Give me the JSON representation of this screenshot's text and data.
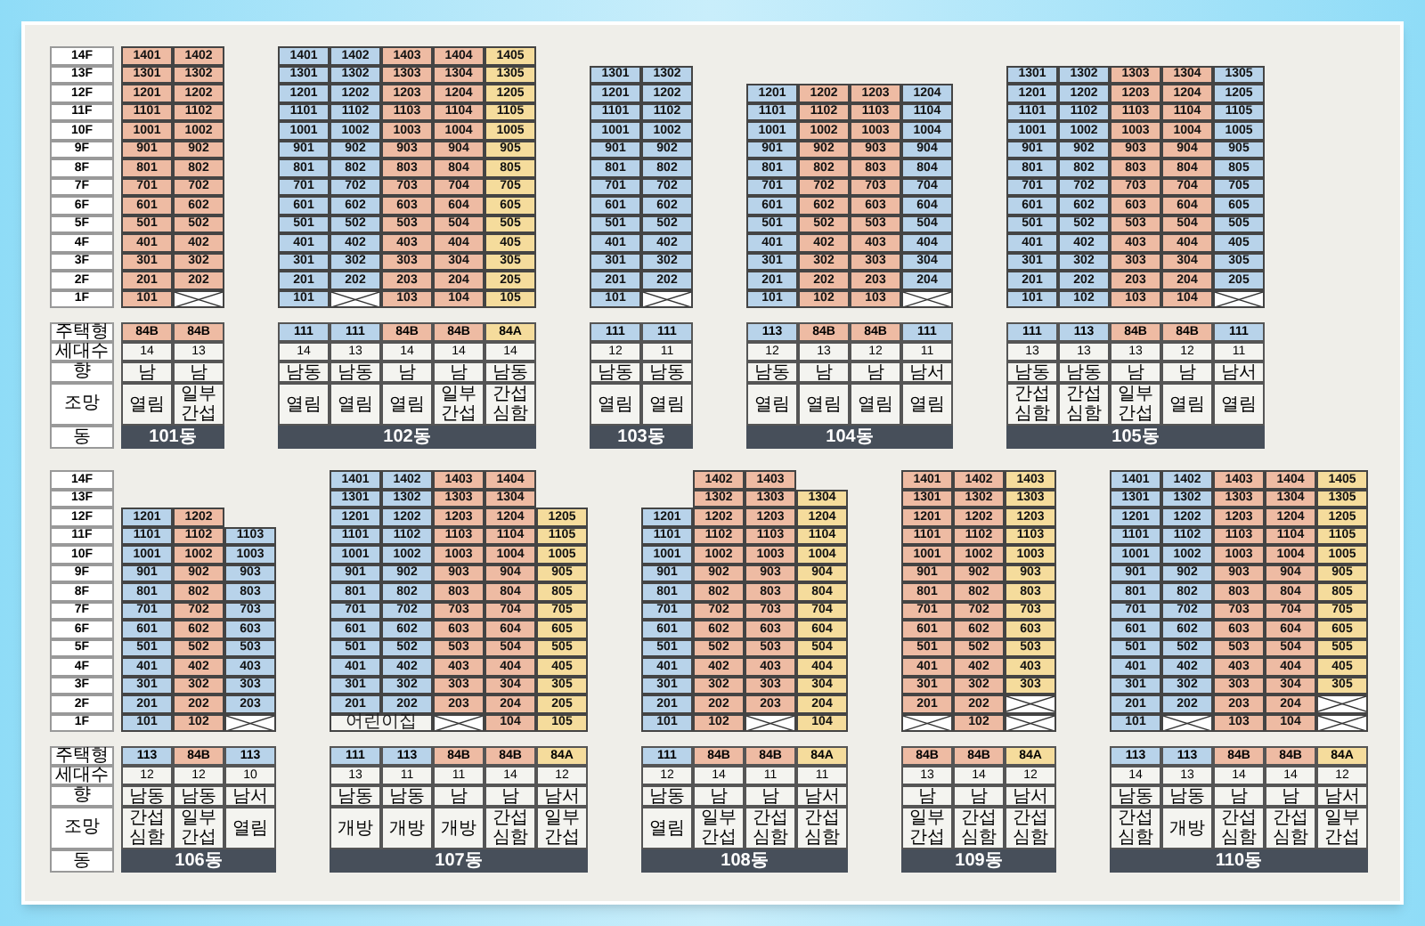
{
  "bands": [
    {
      "floor_labels": [
        "14F",
        "13F",
        "12F",
        "11F",
        "10F",
        "9F",
        "8F",
        "7F",
        "6F",
        "5F",
        "4F",
        "3F",
        "2F",
        "1F"
      ],
      "info_labels": [
        "주택형",
        "세대수",
        "향",
        "조망",
        "동"
      ],
      "buildings": [
        {
          "name": "101동",
          "columns": [
            {
              "color": "#eebba3",
              "type": "84B",
              "count": "14",
              "direction": "남",
              "view": "열림",
              "cells": [
                "1401",
                "1301",
                "1201",
                "1101",
                "1001",
                "901",
                "801",
                "701",
                "601",
                "501",
                "401",
                "301",
                "201",
                "101"
              ]
            },
            {
              "color": "#eebba3",
              "type": "84B",
              "count": "13",
              "direction": "남",
              "view": "일부간섭",
              "cells": [
                "1402",
                "1302",
                "1202",
                "1102",
                "1002",
                "902",
                "802",
                "702",
                "602",
                "502",
                "402",
                "302",
                "202",
                null
              ]
            }
          ]
        },
        {
          "name": "102동",
          "columns": [
            {
              "color": "#b8d3ea",
              "type": "111",
              "count": "14",
              "direction": "남동",
              "view": "열림",
              "cells": [
                "1401",
                "1301",
                "1201",
                "1101",
                "1001",
                "901",
                "801",
                "701",
                "601",
                "501",
                "401",
                "301",
                "201",
                "101"
              ]
            },
            {
              "color": "#b8d3ea",
              "type": "111",
              "count": "13",
              "direction": "남동",
              "view": "열림",
              "cells": [
                "1402",
                "1302",
                "1202",
                "1102",
                "1002",
                "902",
                "802",
                "702",
                "602",
                "502",
                "402",
                "302",
                "202",
                null
              ]
            },
            {
              "color": "#eebba3",
              "type": "84B",
              "count": "14",
              "direction": "남",
              "view": "열림",
              "cells": [
                "1403",
                "1303",
                "1203",
                "1103",
                "1003",
                "903",
                "803",
                "703",
                "603",
                "503",
                "403",
                "303",
                "203",
                "103"
              ]
            },
            {
              "color": "#eebba3",
              "type": "84B",
              "count": "14",
              "direction": "남",
              "view": "일부간섭",
              "cells": [
                "1404",
                "1304",
                "1204",
                "1104",
                "1004",
                "904",
                "804",
                "704",
                "604",
                "504",
                "404",
                "304",
                "204",
                "104"
              ]
            },
            {
              "color": "#f5dc9c",
              "type": "84A",
              "count": "14",
              "direction": "남동",
              "view": "간섭심함",
              "cells": [
                "1405",
                "1305",
                "1205",
                "1105",
                "1005",
                "905",
                "805",
                "705",
                "605",
                "505",
                "405",
                "305",
                "205",
                "105"
              ]
            }
          ]
        },
        {
          "name": "103동",
          "columns": [
            {
              "color": "#b8d3ea",
              "type": "111",
              "count": "12",
              "direction": "남동",
              "view": "열림",
              "cells": [
                "1301",
                "1201",
                "1101",
                "1001",
                "901",
                "801",
                "701",
                "601",
                "501",
                "401",
                "301",
                "201",
                "101"
              ]
            },
            {
              "color": "#b8d3ea",
              "type": "111",
              "count": "11",
              "direction": "남동",
              "view": "열림",
              "cells": [
                "1302",
                "1202",
                "1102",
                "1002",
                "902",
                "802",
                "702",
                "602",
                "502",
                "402",
                "302",
                "202",
                null
              ]
            }
          ]
        },
        {
          "name": "104동",
          "columns": [
            {
              "color": "#b8d3ea",
              "type": "113",
              "count": "12",
              "direction": "남동",
              "view": "열림",
              "cells": [
                "1201",
                "1101",
                "1001",
                "901",
                "801",
                "701",
                "601",
                "501",
                "401",
                "301",
                "201",
                "101"
              ]
            },
            {
              "color": "#eebba3",
              "type": "84B",
              "count": "13",
              "direction": "남",
              "view": "열림",
              "cells": [
                "1202",
                "1102",
                "1002",
                "902",
                "802",
                "702",
                "602",
                "502",
                "402",
                "302",
                "202",
                "102"
              ]
            },
            {
              "color": "#eebba3",
              "type": "84B",
              "count": "12",
              "direction": "남",
              "view": "열림",
              "cells": [
                "1203",
                "1103",
                "1003",
                "903",
                "803",
                "703",
                "603",
                "503",
                "403",
                "303",
                "203",
                "103"
              ]
            },
            {
              "color": "#b8d3ea",
              "type": "111",
              "count": "11",
              "direction": "남서",
              "view": "열림",
              "cells": [
                "1204",
                "1104",
                "1004",
                "904",
                "804",
                "704",
                "604",
                "504",
                "404",
                "304",
                "204",
                null
              ]
            }
          ]
        },
        {
          "name": "105동",
          "columns": [
            {
              "color": "#b8d3ea",
              "type": "111",
              "count": "13",
              "direction": "남동",
              "view": "간섭심함",
              "cells": [
                "1301",
                "1201",
                "1101",
                "1001",
                "901",
                "801",
                "701",
                "601",
                "501",
                "401",
                "301",
                "201",
                "101"
              ]
            },
            {
              "color": "#b8d3ea",
              "type": "113",
              "count": "13",
              "direction": "남동",
              "view": "간섭심함",
              "cells": [
                "1302",
                "1202",
                "1102",
                "1002",
                "902",
                "802",
                "702",
                "602",
                "502",
                "402",
                "302",
                "202",
                "102"
              ]
            },
            {
              "color": "#eebba3",
              "type": "84B",
              "count": "13",
              "direction": "남",
              "view": "일부간섭",
              "cells": [
                "1303",
                "1203",
                "1103",
                "1003",
                "903",
                "803",
                "703",
                "603",
                "503",
                "403",
                "303",
                "203",
                "103"
              ]
            },
            {
              "color": "#eebba3",
              "type": "84B",
              "count": "12",
              "direction": "남",
              "view": "열림",
              "cells": [
                "1304",
                "1204",
                "1104",
                "1004",
                "904",
                "804",
                "704",
                "604",
                "504",
                "404",
                "304",
                "204",
                "104"
              ]
            },
            {
              "color": "#b8d3ea",
              "type": "111",
              "count": "11",
              "direction": "남서",
              "view": "열림",
              "cells": [
                "1305",
                "1205",
                "1105",
                "1005",
                "905",
                "805",
                "705",
                "605",
                "505",
                "405",
                "305",
                "205",
                null
              ]
            }
          ]
        }
      ]
    },
    {
      "floor_labels": [
        "14F",
        "13F",
        "12F",
        "11F",
        "10F",
        "9F",
        "8F",
        "7F",
        "6F",
        "5F",
        "4F",
        "3F",
        "2F",
        "1F"
      ],
      "info_labels": [
        "주택형",
        "세대수",
        "향",
        "조망",
        "동"
      ],
      "buildings": [
        {
          "name": "106동",
          "columns": [
            {
              "color": "#b8d3ea",
              "type": "113",
              "count": "12",
              "direction": "남동",
              "view": "간섭심함",
              "cells": [
                "1201",
                "1101",
                "1001",
                "901",
                "801",
                "701",
                "601",
                "501",
                "401",
                "301",
                "201",
                "101"
              ]
            },
            {
              "color": "#eebba3",
              "type": "84B",
              "count": "12",
              "direction": "남동",
              "view": "일부간섭",
              "cells": [
                "1202",
                "1102",
                "1002",
                "902",
                "802",
                "702",
                "602",
                "502",
                "402",
                "302",
                "202",
                "102"
              ]
            },
            {
              "color": "#b8d3ea",
              "type": "113",
              "count": "10",
              "direction": "남서",
              "view": "열림",
              "cells": [
                "1103",
                "1003",
                "903",
                "803",
                "703",
                "603",
                "503",
                "403",
                "303",
                "203",
                null
              ]
            }
          ]
        },
        {
          "name": "107동",
          "columns": [
            {
              "color": "#b8d3ea",
              "type": "111",
              "count": "13",
              "direction": "남동",
              "view": "개방",
              "cells": [
                "1401",
                "1301",
                "1201",
                "1101",
                "1001",
                "901",
                "801",
                "701",
                "601",
                "501",
                "401",
                "301",
                "201",
                {
                  "kind": "wide",
                  "text": "어린이집"
                }
              ]
            },
            {
              "color": "#b8d3ea",
              "type": "113",
              "count": "11",
              "direction": "남동",
              "view": "개방",
              "cells": [
                "1402",
                "1302",
                "1202",
                "1102",
                "1002",
                "902",
                "802",
                "702",
                "602",
                "502",
                "402",
                "302",
                "202",
                {
                  "kind": "joined"
                }
              ]
            },
            {
              "color": "#eebba3",
              "type": "84B",
              "count": "11",
              "direction": "남",
              "view": "개방",
              "cells": [
                "1403",
                "1303",
                "1203",
                "1103",
                "1003",
                "903",
                "803",
                "703",
                "603",
                "503",
                "403",
                "303",
                "203",
                null
              ]
            },
            {
              "color": "#eebba3",
              "type": "84B",
              "count": "14",
              "direction": "남",
              "view": "간섭심함",
              "cells": [
                "1404",
                "1304",
                "1204",
                "1104",
                "1004",
                "904",
                "804",
                "704",
                "604",
                "504",
                "404",
                "304",
                "204",
                "104"
              ]
            },
            {
              "color": "#f5dc9c",
              "type": "84A",
              "count": "12",
              "direction": "남서",
              "view": "일부간섭",
              "cells": [
                "1205",
                "1105",
                "1005",
                "905",
                "805",
                "705",
                "605",
                "505",
                "405",
                "305",
                "205",
                "105"
              ]
            }
          ]
        },
        {
          "name": "108동",
          "columns": [
            {
              "color": "#b8d3ea",
              "type": "111",
              "count": "12",
              "direction": "남동",
              "view": "열림",
              "cells": [
                "1201",
                "1101",
                "1001",
                "901",
                "801",
                "701",
                "601",
                "501",
                "401",
                "301",
                "201",
                "101"
              ]
            },
            {
              "color": "#eebba3",
              "type": "84B",
              "count": "14",
              "direction": "남",
              "view": "일부간섭",
              "cells": [
                "1402",
                "1302",
                "1202",
                "1102",
                "1002",
                "902",
                "802",
                "702",
                "602",
                "502",
                "402",
                "302",
                "202",
                "102"
              ]
            },
            {
              "color": "#eebba3",
              "type": "84B",
              "count": "11",
              "direction": "남",
              "view": "간섭심함",
              "cells": [
                "1403",
                "1303",
                "1203",
                "1103",
                "1003",
                "903",
                "803",
                "703",
                "603",
                "503",
                "403",
                "303",
                "203",
                null
              ]
            },
            {
              "color": "#f5dc9c",
              "type": "84A",
              "count": "11",
              "direction": "남서",
              "view": "간섭심함",
              "cells": [
                "1304",
                "1204",
                "1104",
                "1004",
                "904",
                "804",
                "704",
                "604",
                "504",
                "404",
                "304",
                "204",
                "104"
              ]
            }
          ]
        },
        {
          "name": "109동",
          "columns": [
            {
              "color": "#eebba3",
              "type": "84B",
              "count": "13",
              "direction": "남",
              "view": "일부간섭",
              "cells": [
                "1401",
                "1301",
                "1201",
                "1101",
                "1001",
                "901",
                "801",
                "701",
                "601",
                "501",
                "401",
                "301",
                "201",
                null
              ]
            },
            {
              "color": "#eebba3",
              "type": "84B",
              "count": "14",
              "direction": "남",
              "view": "간섭심함",
              "cells": [
                "1402",
                "1302",
                "1202",
                "1102",
                "1002",
                "902",
                "802",
                "702",
                "602",
                "502",
                "402",
                "302",
                "202",
                "102"
              ]
            },
            {
              "color": "#f5dc9c",
              "type": "84A",
              "count": "12",
              "direction": "남서",
              "view": "간섭심함",
              "cells": [
                "1403",
                "1303",
                "1203",
                "1103",
                "1003",
                "903",
                "803",
                "703",
                "603",
                "503",
                "403",
                "303",
                null,
                null
              ]
            }
          ]
        },
        {
          "name": "110동",
          "columns": [
            {
              "color": "#b8d3ea",
              "type": "113",
              "count": "14",
              "direction": "남동",
              "view": "간섭심함",
              "cells": [
                "1401",
                "1301",
                "1201",
                "1101",
                "1001",
                "901",
                "801",
                "701",
                "601",
                "501",
                "401",
                "301",
                "201",
                "101"
              ]
            },
            {
              "color": "#b8d3ea",
              "type": "113",
              "count": "13",
              "direction": "남동",
              "view": "개방",
              "cells": [
                "1402",
                "1302",
                "1202",
                "1102",
                "1002",
                "902",
                "802",
                "702",
                "602",
                "502",
                "402",
                "302",
                "202",
                null
              ]
            },
            {
              "color": "#eebba3",
              "type": "84B",
              "count": "14",
              "direction": "남",
              "view": "간섭심함",
              "cells": [
                "1403",
                "1303",
                "1203",
                "1103",
                "1003",
                "903",
                "803",
                "703",
                "603",
                "503",
                "403",
                "303",
                "203",
                "103"
              ]
            },
            {
              "color": "#eebba3",
              "type": "84B",
              "count": "14",
              "direction": "남",
              "view": "간섭심함",
              "cells": [
                "1404",
                "1304",
                "1204",
                "1104",
                "1004",
                "904",
                "804",
                "704",
                "604",
                "504",
                "404",
                "304",
                "204",
                "104"
              ]
            },
            {
              "color": "#f5dc9c",
              "type": "84A",
              "count": "12",
              "direction": "남서",
              "view": "일부간섭",
              "cells": [
                "1405",
                "1305",
                "1205",
                "1105",
                "1005",
                "905",
                "805",
                "705",
                "605",
                "505",
                "405",
                "305",
                null,
                null
              ]
            }
          ]
        }
      ]
    }
  ]
}
